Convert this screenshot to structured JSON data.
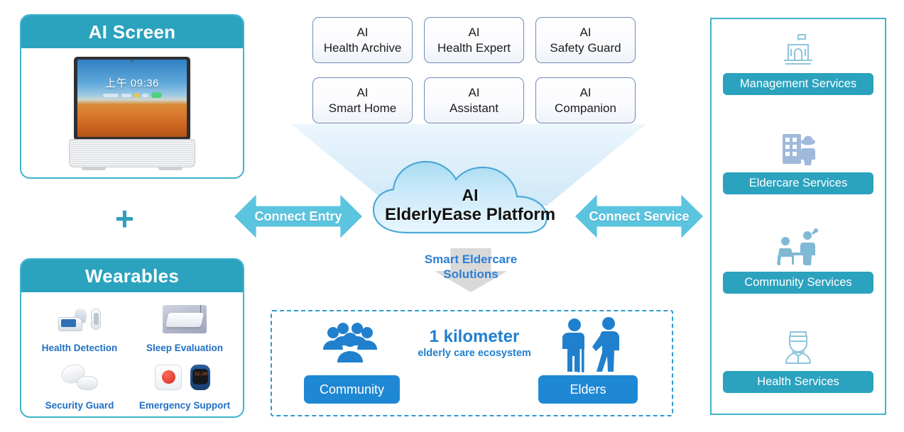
{
  "left_column": {
    "ai_screen_card": {
      "title": "AI Screen",
      "device": {
        "time_text": "上午 09:36",
        "icon_names": [
          "weather-widget",
          "status-dot-yellow",
          "status-dot-green",
          "status-pill-green"
        ]
      }
    },
    "plus_symbol": "+",
    "wearables_card": {
      "title": "Wearables",
      "items": [
        {
          "label": "Health Detection",
          "icons": [
            "blood-pressure-monitor-icon",
            "thermometer-icon"
          ]
        },
        {
          "label": "Sleep Evaluation",
          "icons": [
            "sleep-mattress-sensor-icon"
          ]
        },
        {
          "label": "Security Guard",
          "icons": [
            "smoke-detector-icon"
          ]
        },
        {
          "label": "Emergency Support",
          "icons": [
            "sos-button-icon",
            "smart-watch-icon"
          ]
        }
      ]
    }
  },
  "center_column": {
    "ai_features": [
      {
        "line1": "AI",
        "line2": "Health Archive"
      },
      {
        "line1": "AI",
        "line2": "Health Expert"
      },
      {
        "line1": "AI",
        "line2": "Safety Guard"
      },
      {
        "line1": "AI",
        "line2": "Smart Home"
      },
      {
        "line1": "AI",
        "line2": "Assistant"
      },
      {
        "line1": "AI",
        "line2": "Companion"
      }
    ],
    "cloud": {
      "line1": "AI",
      "line2": "ElderlyEase Platform"
    },
    "left_arrow_label": "Connect Entry",
    "right_arrow_label": "Connect Service",
    "solutions_caption": {
      "line1": "Smart Eldercare",
      "line2": "Solutions"
    },
    "ecosystem": {
      "headline": "1 kilometer",
      "subhead": "elderly care ecosystem",
      "left_button": "Community",
      "right_button": "Elders",
      "left_icon": "people-group-icon",
      "right_icon": "elderly-with-caregiver-icon"
    }
  },
  "right_column": {
    "services": [
      {
        "label": "Management Services",
        "icon": "government-building-icon"
      },
      {
        "label": "Eldercare Services",
        "icon": "nursing-home-resident-icon"
      },
      {
        "label": "Community Services",
        "icon": "community-care-icon"
      },
      {
        "label": "Health Services",
        "icon": "doctor-icon"
      }
    ]
  },
  "colors": {
    "teal": "#2BA2BE",
    "teal_border": "#3FB3CE",
    "arrow_blue": "#5BC4DF",
    "button_blue": "#1F88D4",
    "label_blue": "#1F6FC4",
    "dashed_blue": "#2F9BC9",
    "box_border": "#6C8CB6",
    "gray_arrow": "#D9D9D9"
  }
}
